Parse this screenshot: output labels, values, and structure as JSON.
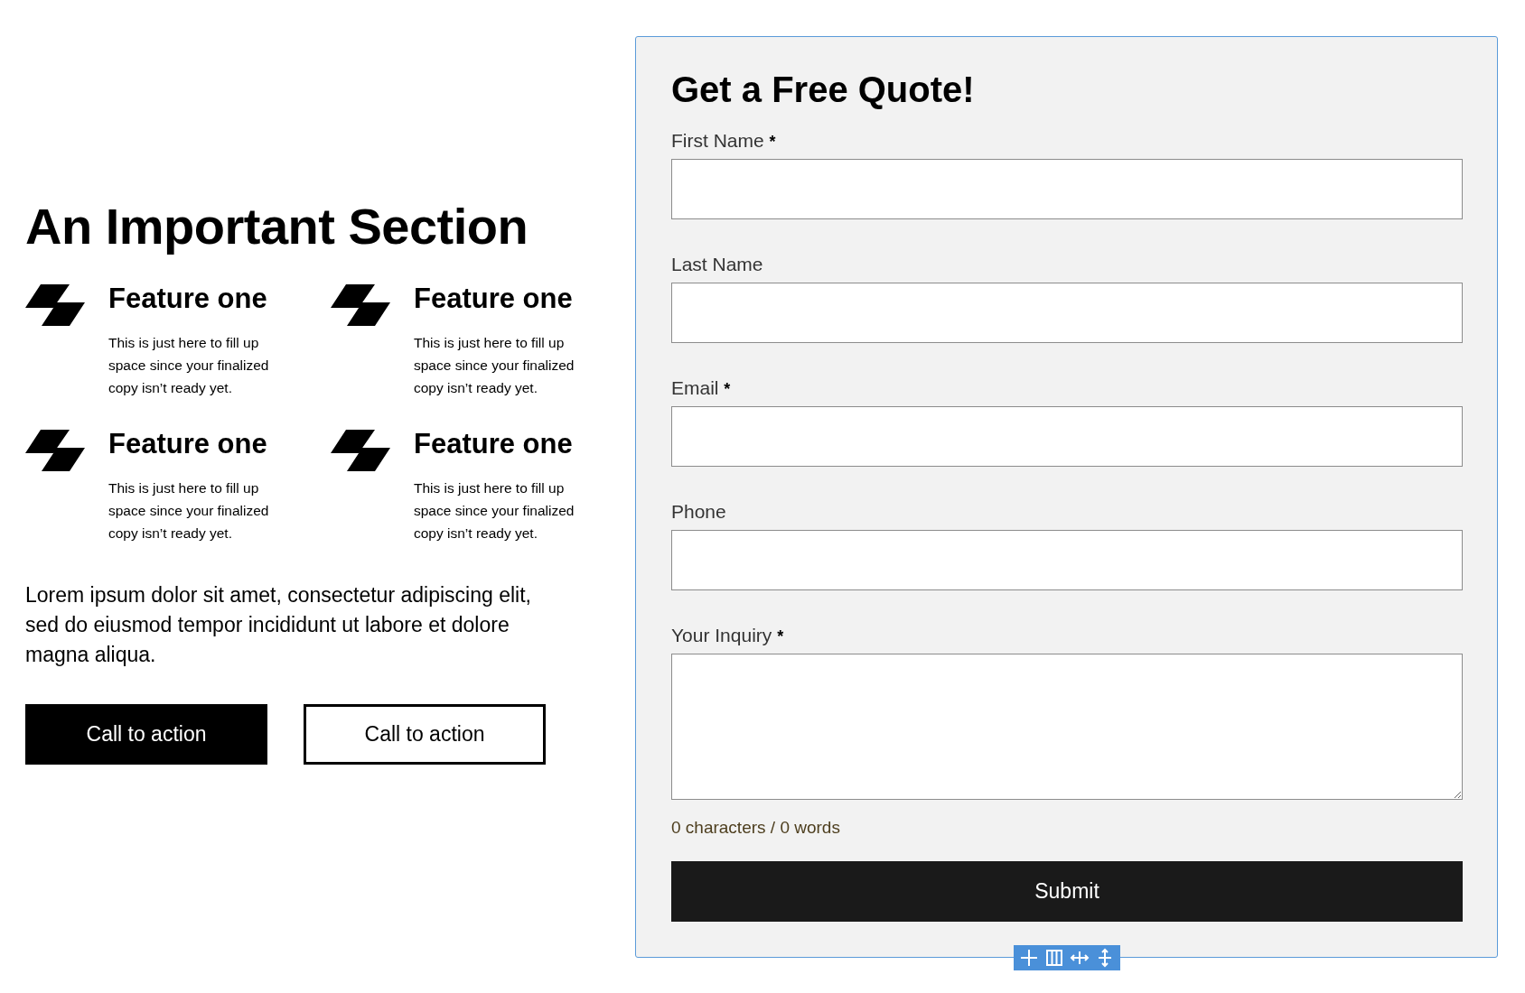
{
  "section": {
    "title": "An Important Section",
    "features": [
      {
        "title": "Feature one",
        "text": "This is just here to fill up space since your finalized copy isn’t ready yet."
      },
      {
        "title": "Feature one",
        "text": "This is just here to fill up space since your finalized copy isn’t ready yet."
      },
      {
        "title": "Feature one",
        "text": "This is just here to fill up space since your finalized copy isn’t ready yet."
      },
      {
        "title": "Feature one",
        "text": "This is just here to fill up space since your finalized copy isn’t ready yet."
      }
    ],
    "paragraph": "Lorem ipsum dolor sit amet, consectetur adipiscing elit, sed do eiusmod tempor incididunt ut labore et dolore magna aliqua.",
    "buttons": [
      {
        "label": "Call to action",
        "kind": "filled"
      },
      {
        "label": "Call to action",
        "kind": "outline"
      }
    ]
  },
  "form": {
    "title": "Get a Free Quote!",
    "fields": [
      {
        "label": "First Name",
        "mark": "*",
        "kind": "input"
      },
      {
        "label": "Last Name",
        "kind": "input"
      },
      {
        "label": "Email",
        "mark": "*",
        "kind": "input"
      },
      {
        "label": "Phone",
        "kind": "input"
      },
      {
        "label": "Your Inquiry",
        "mark": "*",
        "kind": "textarea"
      }
    ],
    "counter": "0 characters / 0 words",
    "submit": "Submit"
  }
}
